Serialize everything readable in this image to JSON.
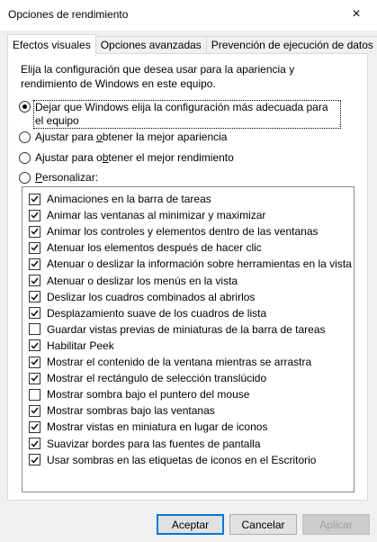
{
  "window": {
    "title": "Opciones de rendimiento",
    "close_icon": "×"
  },
  "tabs": [
    {
      "label": "Efectos visuales",
      "active": true
    },
    {
      "label": "Opciones avanzadas",
      "active": false
    },
    {
      "label": "Prevención de ejecución de datos",
      "active": false
    }
  ],
  "intro": "Elija la configuración que desea usar para la apariencia y rendimiento de Windows en este equipo.",
  "radios": [
    {
      "label": "Dejar que Windows elija la configuración más adecuada para el equipo",
      "selected": true
    },
    {
      "label": "Ajustar para obtener la mejor apariencia",
      "selected": false
    },
    {
      "label": "Ajustar para obtener el mejor rendimiento",
      "selected": false
    },
    {
      "label": "Personalizar:",
      "selected": false
    }
  ],
  "effects": [
    {
      "label": "Animaciones en la barra de tareas",
      "checked": true
    },
    {
      "label": "Animar las ventanas al minimizar y maximizar",
      "checked": true
    },
    {
      "label": "Animar los controles y elementos dentro de las ventanas",
      "checked": true
    },
    {
      "label": "Atenuar los elementos después de hacer clic",
      "checked": true
    },
    {
      "label": "Atenuar o deslizar la información sobre herramientas en la vista",
      "checked": true
    },
    {
      "label": "Atenuar o deslizar los menús en la vista",
      "checked": true
    },
    {
      "label": "Deslizar los cuadros combinados al abrirlos",
      "checked": true
    },
    {
      "label": "Desplazamiento suave de los cuadros de lista",
      "checked": true
    },
    {
      "label": "Guardar vistas previas de miniaturas de la barra de tareas",
      "checked": false
    },
    {
      "label": "Habilitar Peek",
      "checked": true
    },
    {
      "label": "Mostrar el contenido de la ventana mientras se arrastra",
      "checked": true
    },
    {
      "label": "Mostrar el rectángulo de selección translúcido",
      "checked": true
    },
    {
      "label": "Mostrar sombra bajo el puntero del mouse",
      "checked": false
    },
    {
      "label": "Mostrar sombras bajo las ventanas",
      "checked": true
    },
    {
      "label": "Mostrar vistas en miniatura en lugar de iconos",
      "checked": true
    },
    {
      "label": "Suavizar bordes para las fuentes de pantalla",
      "checked": true
    },
    {
      "label": "Usar sombras en las etiquetas de iconos en el Escritorio",
      "checked": true
    }
  ],
  "buttons": {
    "accept": "Aceptar",
    "cancel": "Cancelar",
    "apply": "Aplicar"
  },
  "colors": {
    "default_button_border": "#0078d7",
    "panel_bg": "#ffffff",
    "dialog_bg": "#f0f0f0"
  }
}
